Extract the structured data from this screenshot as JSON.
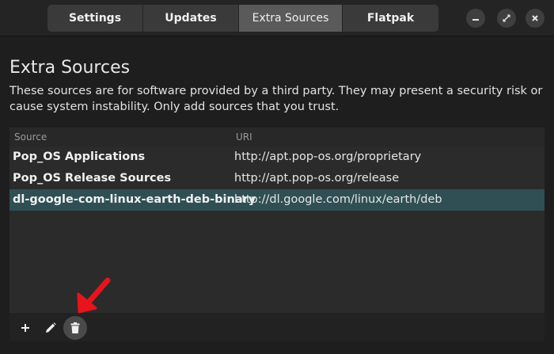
{
  "header": {
    "tabs": [
      {
        "label": "Settings",
        "active": false
      },
      {
        "label": "Updates",
        "active": false
      },
      {
        "label": "Extra Sources",
        "active": true
      },
      {
        "label": "Flatpak",
        "active": false
      }
    ],
    "window_buttons": [
      "minimize-icon",
      "maximize-icon",
      "close-icon"
    ]
  },
  "main": {
    "title": "Extra Sources",
    "description": "These sources are for software provided by a third party. They may present a security risk or cause system instability. Only add sources that you trust."
  },
  "sources": {
    "columns": {
      "source": "Source",
      "uri": "URI"
    },
    "rows": [
      {
        "source": "Pop_OS Applications",
        "uri": "http://apt.pop-os.org/proprietary"
      },
      {
        "source": "Pop_OS Release Sources",
        "uri": "http://apt.pop-os.org/release"
      },
      {
        "source": "dl-google-com-linux-earth-deb-binary",
        "uri": "http://dl.google.com/linux/earth/deb"
      }
    ],
    "selected_row": 2,
    "toolbar": [
      "add-icon",
      "edit-icon",
      "delete-icon"
    ]
  },
  "colors": {
    "background": "#1e1e1e",
    "selection": "#2f4f54",
    "annotation_arrow": "#e8141b"
  }
}
